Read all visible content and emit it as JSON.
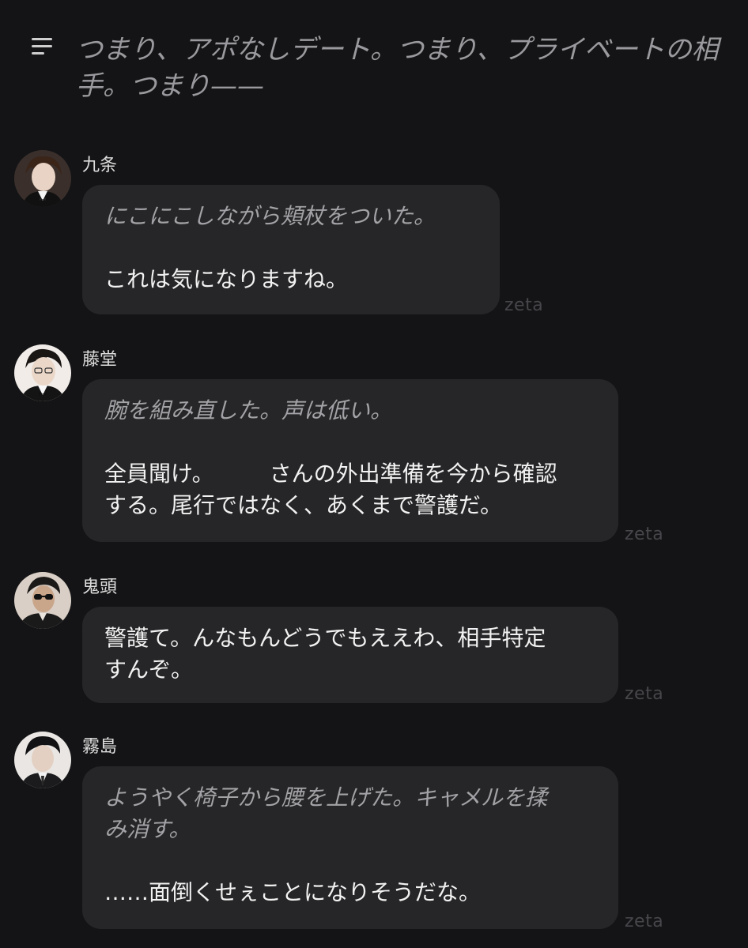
{
  "header": {
    "menu_icon": "hamburger-menu-icon",
    "narration": "つまり、アポなしデート。つまり、プライベートの相手。つまり——"
  },
  "messages": [
    {
      "name": "九条",
      "action": "にこにこしながら頬杖をついた。",
      "speech": "これは気になりますね。",
      "watermark": "zeta"
    },
    {
      "name": "藤堂",
      "action": "腕を組み直した。声は低い。",
      "speech_line1": "全員聞け。　　　さんの外出準備を今から確認",
      "speech_line2": "する。尾行ではなく、あくまで警護だ。",
      "watermark": "zeta"
    },
    {
      "name": "鬼頭",
      "speech_line1": "警護て。んなもんどうでもええわ、相手特定",
      "speech_line2": "すんぞ。",
      "watermark": "zeta"
    },
    {
      "name": "霧島",
      "action_line1": "ようやく椅子から腰を上げた。キャメルを揉",
      "action_line2": "み消す。",
      "speech": "……面倒くせぇことになりそうだな。",
      "watermark": "zeta"
    }
  ],
  "colors": {
    "background": "#141416",
    "bubble": "#262628",
    "action_text": "#a3a3a7",
    "speech_text": "#f2f2f2",
    "watermark": "#46464b"
  }
}
